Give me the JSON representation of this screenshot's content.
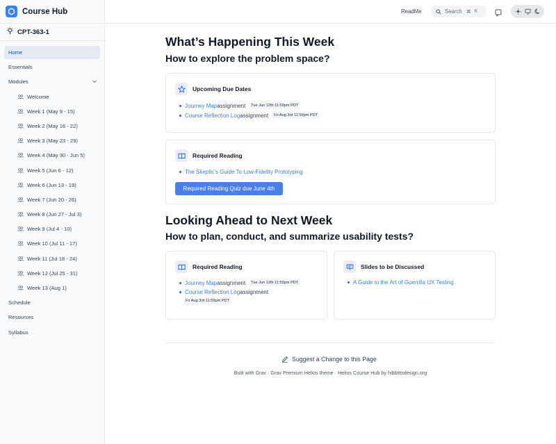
{
  "brand": {
    "name": "Course Hub",
    "course_code": "CPT-363-1"
  },
  "colors": {
    "accent": "#3b82f6",
    "link": "#3b7fd8",
    "button": "#4a7ee8"
  },
  "sidebar": {
    "items": [
      {
        "label": "Home",
        "active": true
      },
      {
        "label": "Essentials"
      },
      {
        "label": "Modules"
      },
      {
        "label": "Schedule"
      },
      {
        "label": "Resources"
      },
      {
        "label": "Syllabus"
      }
    ],
    "modules": [
      "Welcome",
      "Week 1 (May 9 - 15)",
      "Week 2 (May 16 - 22)",
      "Week 3 (May 23 - 29)",
      "Week 4 (May 30 - Jun 5)",
      "Week 5 (Jun 6 - 12)",
      "Week 6 (Jun 13 - 19)",
      "Week 7 (Jun 20 - 26)",
      "Week 8 (Jun 27 - Jul 3)",
      "Week 9 (Jul 4 - 10)",
      "Week 10 (Jul 11 - 17)",
      "Week 11 (Jul 18 - 24)",
      "Week 12 (Jul 25 - 31)",
      "Week 13 (Aug 1)"
    ]
  },
  "header": {
    "readme": "ReadMe",
    "search_placeholder": "Search",
    "kbd_cmd": "⌘",
    "kbd_key": "K"
  },
  "main": {
    "section1": {
      "title": "What’s Happening This Week",
      "subtitle": "How to explore the problem space?",
      "due_card": {
        "title": "Upcoming Due Dates",
        "items": [
          {
            "link": "Journey Map",
            "text": " assignment",
            "badge": "Tue Jun 12th 11:59pm PDT"
          },
          {
            "link": "Course Reflection Log",
            "text": " assignment",
            "badge": "Fri Aug 3rd 11:59pm PDT"
          }
        ]
      },
      "reading_card": {
        "title": "Required Reading",
        "link": "The Skeptic’s Guide To Low-Fidelity Prototyping",
        "button": "Required Reading Quiz due June 4th"
      }
    },
    "section2": {
      "title": "Looking Ahead to Next Week",
      "subtitle": "How to plan, conduct, and summarize usability tests?",
      "reading_card": {
        "title": "Required Reading",
        "items": [
          {
            "link": "Journey Map",
            "text": " assignment",
            "badge": "Tue Jun 12th 11:59pm PDT"
          },
          {
            "link": "Course Reflection Log",
            "text": " assignment",
            "badge": "Fri Aug 3rd 11:59pm PDT"
          }
        ]
      },
      "slides_card": {
        "title": "Slides to be Discussed",
        "link": "A Guide to the Art of Guerrilla UX Testing"
      }
    },
    "suggest": "Suggest a Change to this Page",
    "footer": "Built with Grav · Grav Premium Helios theme · Helios Course Hub by hibbittsdesign.org"
  }
}
